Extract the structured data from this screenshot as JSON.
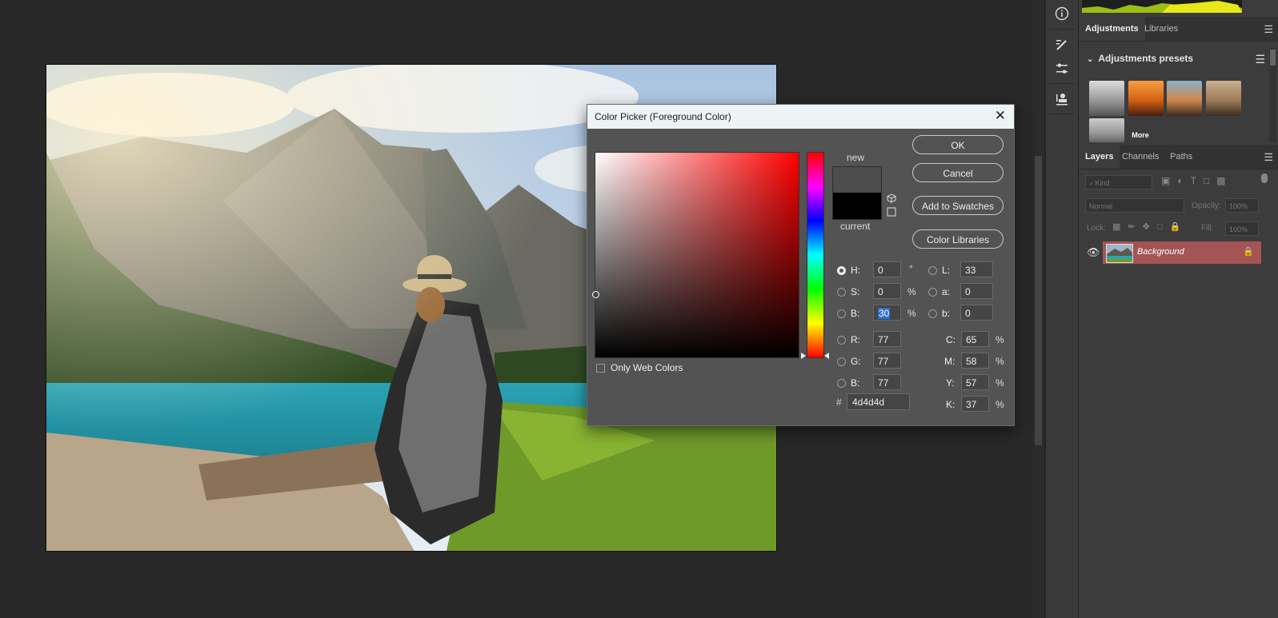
{
  "canvas": {
    "image_description_icon": "photo-of-woman-by-mountain-lake"
  },
  "toolstrip": {
    "tools": [
      "info-icon",
      "brush-settings-icon",
      "adjustments-sliders-icon",
      "clone-source-icon"
    ]
  },
  "panels": {
    "top_tabs": [
      "Adjustments",
      "Libraries"
    ],
    "adjustments_presets_label": "Adjustments presets",
    "more_label": "More",
    "layer_tabs": [
      "Layers",
      "Channels",
      "Paths"
    ],
    "kind_label": "Kind",
    "blend_mode": "Normal",
    "opacity_label": "Opacity:",
    "opacity_value": "100%",
    "lock_label": "Lock:",
    "fill_label": "Fill:",
    "fill_value": "100%",
    "layer_name": "Background",
    "accent_color": "#a45454"
  },
  "dialog": {
    "title": "Color Picker (Foreground Color)",
    "new_label": "new",
    "current_label": "current",
    "new_color": "#4d4d4d",
    "current_color": "#000000",
    "buttons": {
      "ok": "OK",
      "cancel": "Cancel",
      "add_to_swatches": "Add to Swatches",
      "color_libraries": "Color Libraries"
    },
    "only_web_colors": "Only Web Colors",
    "fields": {
      "h_label": "H:",
      "h_value": "0",
      "h_unit": "°",
      "s_label": "S:",
      "s_value": "0",
      "s_unit": "%",
      "b_label": "B:",
      "b_value": "30",
      "b_unit": "%",
      "r_label": "R:",
      "r_value": "77",
      "g_label": "G:",
      "g_value": "77",
      "bl_label": "B:",
      "bl_value": "77",
      "l_label": "L:",
      "l_value": "33",
      "a_label": "a:",
      "a_value": "0",
      "lb_label": "b:",
      "lb_value": "0",
      "c_label": "C:",
      "c_value": "65",
      "m_label": "M:",
      "m_value": "58",
      "y_label": "Y:",
      "y_value": "57",
      "k_label": "K:",
      "k_value": "37",
      "pct": "%",
      "hash": "#",
      "hex_value": "4d4d4d"
    }
  }
}
